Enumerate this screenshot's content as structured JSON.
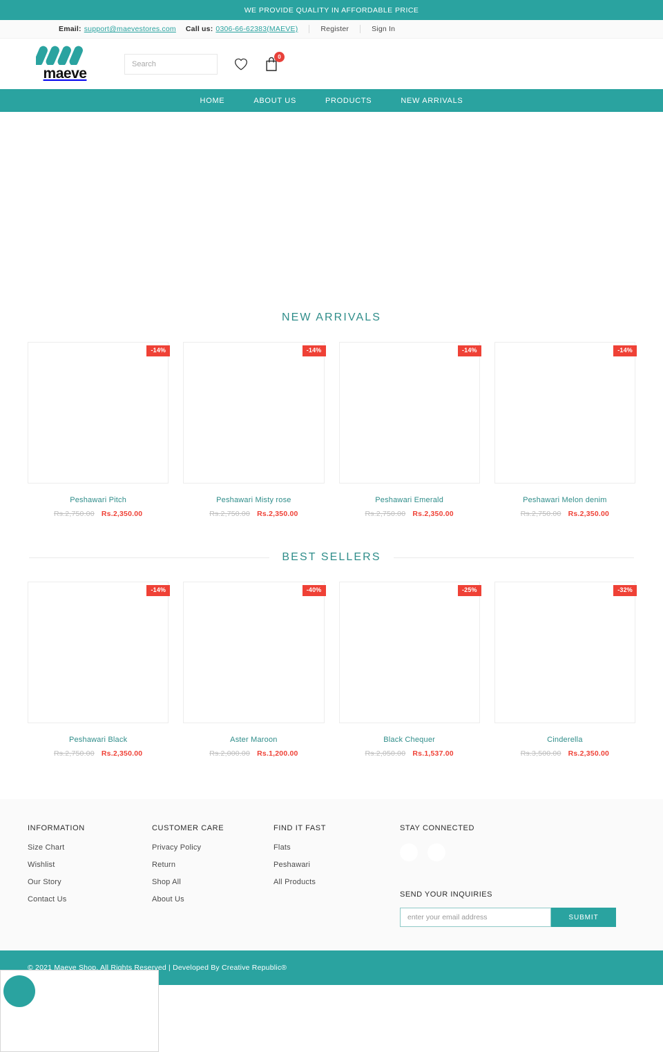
{
  "announcement": {
    "text": "WE PROVIDE QUALITY IN AFFORDABLE PRICE"
  },
  "utility": {
    "email_label": "Email:",
    "email_value": "support@maevestores.com",
    "phone_label": "Call us:",
    "phone_value": "0306-66-62383(MAEVE)",
    "register": "Register",
    "signin": "Sign In"
  },
  "header": {
    "logo_text": "maeve",
    "search_placeholder": "Search",
    "search_value": "",
    "search_icon": "search-icon",
    "wishlist_icon": "heart-icon",
    "cart_icon": "shopping-bag-icon",
    "cart_count": "0"
  },
  "nav": {
    "items": [
      {
        "label": "HOME"
      },
      {
        "label": "ABOUT US"
      },
      {
        "label": "PRODUCTS"
      },
      {
        "label": "NEW ARRIVALS"
      }
    ]
  },
  "sections": {
    "new_arrivals": {
      "title": "NEW ARRIVALS",
      "products": [
        {
          "name": "Peshawari Pitch",
          "old_price": "Rs.2,750.00",
          "new_price": "Rs.2,350.00",
          "discount": "-14%"
        },
        {
          "name": "Peshawari Misty rose",
          "old_price": "Rs.2,750.00",
          "new_price": "Rs.2,350.00",
          "discount": "-14%"
        },
        {
          "name": "Peshawari Emerald",
          "old_price": "Rs.2,750.00",
          "new_price": "Rs.2,350.00",
          "discount": "-14%"
        },
        {
          "name": "Peshawari Melon denim",
          "old_price": "Rs.2,750.00",
          "new_price": "Rs.2,350.00",
          "discount": "-14%"
        }
      ]
    },
    "best_sellers": {
      "title": "BEST SELLERS",
      "products": [
        {
          "name": "Peshawari Black",
          "old_price": "Rs.2,750.00",
          "new_price": "Rs.2,350.00",
          "discount": "-14%"
        },
        {
          "name": "Aster Maroon",
          "old_price": "Rs.2,000.00",
          "new_price": "Rs.1,200.00",
          "discount": "-40%"
        },
        {
          "name": "Black Chequer",
          "old_price": "Rs.2,050.00",
          "new_price": "Rs.1,537.00",
          "discount": "-25%"
        },
        {
          "name": "Cinderella",
          "old_price": "Rs.3,500.00",
          "new_price": "Rs.2,350.00",
          "discount": "-32%"
        }
      ]
    }
  },
  "footer": {
    "information": {
      "heading": "INFORMATION",
      "links": [
        {
          "label": "Size Chart"
        },
        {
          "label": "Wishlist"
        },
        {
          "label": "Our Story"
        },
        {
          "label": "Contact Us"
        }
      ]
    },
    "customer_care": {
      "heading": "CUSTOMER CARE",
      "links": [
        {
          "label": "Privacy Policy"
        },
        {
          "label": "Return"
        },
        {
          "label": "Shop All"
        },
        {
          "label": "About Us"
        }
      ]
    },
    "find_it_fast": {
      "heading": "FIND IT FAST",
      "links": [
        {
          "label": "Flats"
        },
        {
          "label": "Peshawari"
        },
        {
          "label": "All Products"
        }
      ]
    },
    "stay_connected": {
      "heading": "STAY CONNECTED",
      "social_icons": [
        "social-icon-1",
        "social-icon-2"
      ]
    },
    "newsletter": {
      "heading": "SEND YOUR INQUIRIES",
      "placeholder": "enter your email address",
      "value": "",
      "submit_label": "SUBMIT"
    }
  },
  "copyright": {
    "text": "© 2021 Maeve Shop, All Rights Reserved | Developed By Creative Republic®"
  },
  "chat_widget": {
    "button_icon": "chat-bubble-icon"
  },
  "colors": {
    "brand_teal": "#2aa3a0",
    "title_teal": "#2f8d8a",
    "sale_red": "#ef4136",
    "badge_red": "#e8413a"
  }
}
